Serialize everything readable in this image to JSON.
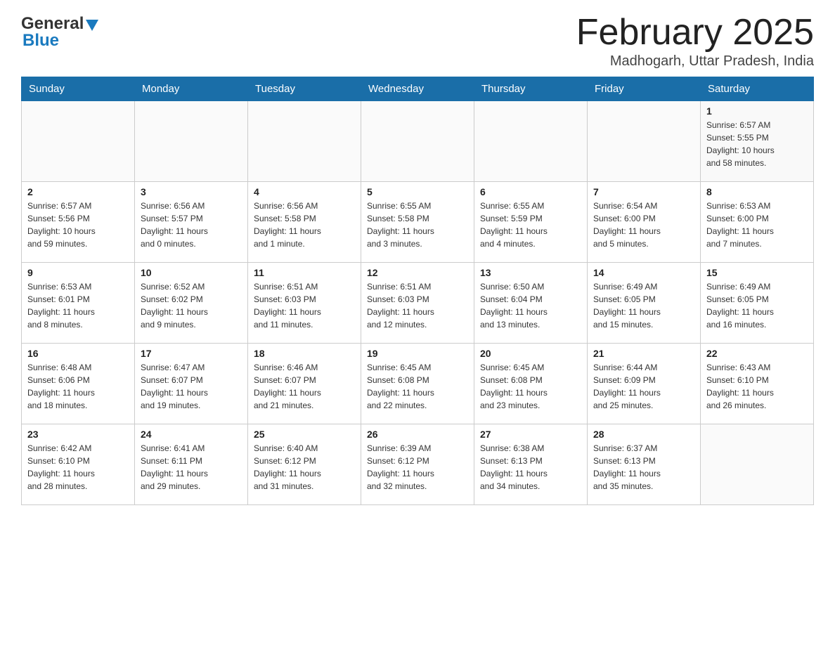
{
  "header": {
    "logo_general": "General",
    "logo_blue": "Blue",
    "month_title": "February 2025",
    "location": "Madhogarh, Uttar Pradesh, India"
  },
  "days_of_week": [
    "Sunday",
    "Monday",
    "Tuesday",
    "Wednesday",
    "Thursday",
    "Friday",
    "Saturday"
  ],
  "weeks": [
    [
      {
        "day": "",
        "info": ""
      },
      {
        "day": "",
        "info": ""
      },
      {
        "day": "",
        "info": ""
      },
      {
        "day": "",
        "info": ""
      },
      {
        "day": "",
        "info": ""
      },
      {
        "day": "",
        "info": ""
      },
      {
        "day": "1",
        "info": "Sunrise: 6:57 AM\nSunset: 5:55 PM\nDaylight: 10 hours\nand 58 minutes."
      }
    ],
    [
      {
        "day": "2",
        "info": "Sunrise: 6:57 AM\nSunset: 5:56 PM\nDaylight: 10 hours\nand 59 minutes."
      },
      {
        "day": "3",
        "info": "Sunrise: 6:56 AM\nSunset: 5:57 PM\nDaylight: 11 hours\nand 0 minutes."
      },
      {
        "day": "4",
        "info": "Sunrise: 6:56 AM\nSunset: 5:58 PM\nDaylight: 11 hours\nand 1 minute."
      },
      {
        "day": "5",
        "info": "Sunrise: 6:55 AM\nSunset: 5:58 PM\nDaylight: 11 hours\nand 3 minutes."
      },
      {
        "day": "6",
        "info": "Sunrise: 6:55 AM\nSunset: 5:59 PM\nDaylight: 11 hours\nand 4 minutes."
      },
      {
        "day": "7",
        "info": "Sunrise: 6:54 AM\nSunset: 6:00 PM\nDaylight: 11 hours\nand 5 minutes."
      },
      {
        "day": "8",
        "info": "Sunrise: 6:53 AM\nSunset: 6:00 PM\nDaylight: 11 hours\nand 7 minutes."
      }
    ],
    [
      {
        "day": "9",
        "info": "Sunrise: 6:53 AM\nSunset: 6:01 PM\nDaylight: 11 hours\nand 8 minutes."
      },
      {
        "day": "10",
        "info": "Sunrise: 6:52 AM\nSunset: 6:02 PM\nDaylight: 11 hours\nand 9 minutes."
      },
      {
        "day": "11",
        "info": "Sunrise: 6:51 AM\nSunset: 6:03 PM\nDaylight: 11 hours\nand 11 minutes."
      },
      {
        "day": "12",
        "info": "Sunrise: 6:51 AM\nSunset: 6:03 PM\nDaylight: 11 hours\nand 12 minutes."
      },
      {
        "day": "13",
        "info": "Sunrise: 6:50 AM\nSunset: 6:04 PM\nDaylight: 11 hours\nand 13 minutes."
      },
      {
        "day": "14",
        "info": "Sunrise: 6:49 AM\nSunset: 6:05 PM\nDaylight: 11 hours\nand 15 minutes."
      },
      {
        "day": "15",
        "info": "Sunrise: 6:49 AM\nSunset: 6:05 PM\nDaylight: 11 hours\nand 16 minutes."
      }
    ],
    [
      {
        "day": "16",
        "info": "Sunrise: 6:48 AM\nSunset: 6:06 PM\nDaylight: 11 hours\nand 18 minutes."
      },
      {
        "day": "17",
        "info": "Sunrise: 6:47 AM\nSunset: 6:07 PM\nDaylight: 11 hours\nand 19 minutes."
      },
      {
        "day": "18",
        "info": "Sunrise: 6:46 AM\nSunset: 6:07 PM\nDaylight: 11 hours\nand 21 minutes."
      },
      {
        "day": "19",
        "info": "Sunrise: 6:45 AM\nSunset: 6:08 PM\nDaylight: 11 hours\nand 22 minutes."
      },
      {
        "day": "20",
        "info": "Sunrise: 6:45 AM\nSunset: 6:08 PM\nDaylight: 11 hours\nand 23 minutes."
      },
      {
        "day": "21",
        "info": "Sunrise: 6:44 AM\nSunset: 6:09 PM\nDaylight: 11 hours\nand 25 minutes."
      },
      {
        "day": "22",
        "info": "Sunrise: 6:43 AM\nSunset: 6:10 PM\nDaylight: 11 hours\nand 26 minutes."
      }
    ],
    [
      {
        "day": "23",
        "info": "Sunrise: 6:42 AM\nSunset: 6:10 PM\nDaylight: 11 hours\nand 28 minutes."
      },
      {
        "day": "24",
        "info": "Sunrise: 6:41 AM\nSunset: 6:11 PM\nDaylight: 11 hours\nand 29 minutes."
      },
      {
        "day": "25",
        "info": "Sunrise: 6:40 AM\nSunset: 6:12 PM\nDaylight: 11 hours\nand 31 minutes."
      },
      {
        "day": "26",
        "info": "Sunrise: 6:39 AM\nSunset: 6:12 PM\nDaylight: 11 hours\nand 32 minutes."
      },
      {
        "day": "27",
        "info": "Sunrise: 6:38 AM\nSunset: 6:13 PM\nDaylight: 11 hours\nand 34 minutes."
      },
      {
        "day": "28",
        "info": "Sunrise: 6:37 AM\nSunset: 6:13 PM\nDaylight: 11 hours\nand 35 minutes."
      },
      {
        "day": "",
        "info": ""
      }
    ]
  ]
}
